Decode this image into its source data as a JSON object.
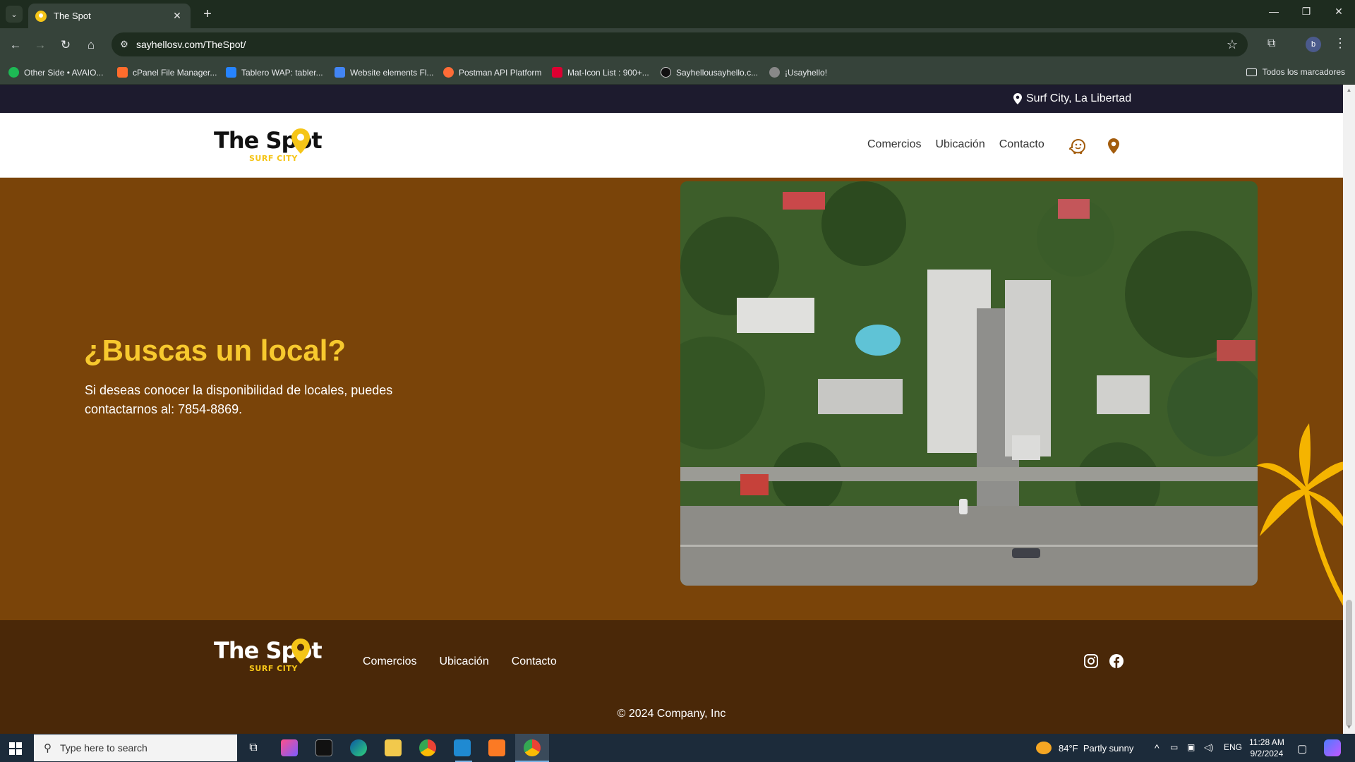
{
  "browser": {
    "tab_title": "The Spot",
    "url": "sayhellosv.com/TheSpot/",
    "profile_initial": "b",
    "bookmarks": [
      {
        "label": "Other Side • AVAIO...",
        "icon": "spotify-icon",
        "color": "#1db954"
      },
      {
        "label": "cPanel File Manager...",
        "icon": "cpanel-icon",
        "color": "#ff6c2c"
      },
      {
        "label": "Tablero WAP: tabler...",
        "icon": "jira-icon",
        "color": "#2684ff"
      },
      {
        "label": "Website elements Fl...",
        "icon": "docs-icon",
        "color": "#4285f4"
      },
      {
        "label": "Postman API Platform",
        "icon": "postman-icon",
        "color": "#ff6c37"
      },
      {
        "label": "Mat-Icon List : 900+...",
        "icon": "angular-icon",
        "color": "#dd0031"
      },
      {
        "label": "Sayhellousayhello.c...",
        "icon": "sayhello-icon",
        "color": "#111111"
      },
      {
        "label": "¡Usayhello!",
        "icon": "globe-icon",
        "color": "#888888"
      }
    ],
    "all_bookmarks_label": "Todos los marcadores"
  },
  "page": {
    "topbar_location": "Surf City, La Libertad",
    "logo": {
      "main": "The Spot",
      "sub": "SURF CITY"
    },
    "nav": [
      "Comercios",
      "Ubicación",
      "Contacto"
    ],
    "hero": {
      "title": "¿Buscas un local?",
      "text": "Si deseas conocer la disponibilidad de locales, puedes contactarnos al: 7854-8869."
    },
    "footer": {
      "nav": [
        "Comercios",
        "Ubicación",
        "Contacto"
      ],
      "copyright": "© 2024 Company, Inc"
    },
    "colors": {
      "brown": "#7a4409",
      "dark_brown": "#4a2808",
      "yellow": "#f7c92e",
      "navy": "#1d1b2e"
    }
  },
  "taskbar": {
    "search_placeholder": "Type here to search",
    "weather_temp": "84°F",
    "weather_text": "Partly sunny",
    "lang": "ENG",
    "time": "11:28 AM",
    "date": "9/2/2024"
  }
}
